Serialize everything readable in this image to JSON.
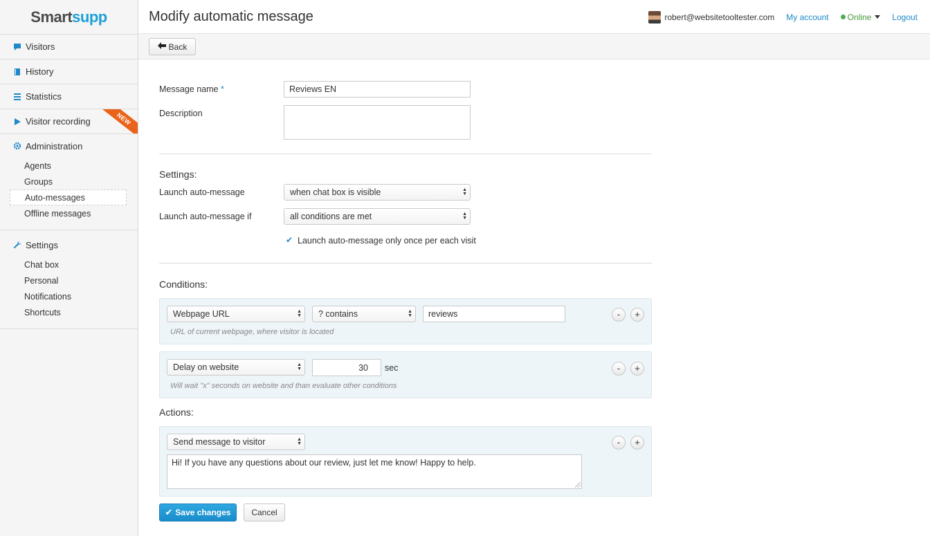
{
  "brand": {
    "part1": "Smart",
    "part2": "supp"
  },
  "sidebar": {
    "items": [
      {
        "label": "Visitors"
      },
      {
        "label": "History"
      },
      {
        "label": "Statistics"
      },
      {
        "label": "Visitor recording",
        "badge": "NEW"
      }
    ],
    "administration": {
      "label": "Administration",
      "items": [
        "Agents",
        "Groups",
        "Auto-messages",
        "Offline messages"
      ],
      "active": "Auto-messages"
    },
    "settings": {
      "label": "Settings",
      "items": [
        "Chat box",
        "Personal",
        "Notifications",
        "Shortcuts"
      ]
    }
  },
  "header": {
    "title": "Modify automatic message",
    "user_email": "robert@websitetooltester.com",
    "my_account": "My account",
    "status": "Online",
    "logout": "Logout"
  },
  "toolbar": {
    "back_label": "Back"
  },
  "form": {
    "message_name_label": "Message name",
    "required_mark": "*",
    "message_name_value": "Reviews EN",
    "description_label": "Description",
    "description_value": "",
    "settings_title": "Settings:",
    "launch_label": "Launch auto-message",
    "launch_value": "when chat box is visible",
    "launch_if_label": "Launch auto-message if",
    "launch_if_value": "all conditions are met",
    "once_label": "Launch auto-message only once per each visit",
    "once_checked": true,
    "conditions_title": "Conditions:",
    "conditions": [
      {
        "type": "Webpage URL",
        "operator": "? contains",
        "value": "reviews",
        "hint": "URL of current webpage, where visitor is located"
      },
      {
        "type": "Delay on website",
        "value": "30",
        "unit": "sec",
        "hint": "Will wait \"x\" seconds on website and than evaluate other conditions"
      }
    ],
    "actions_title": "Actions:",
    "action": {
      "type": "Send message to visitor",
      "message": "Hi! If you have any questions about our review, just let me know! Happy to help."
    },
    "minus": "-",
    "plus": "+",
    "save_label": "Save changes",
    "cancel_label": "Cancel"
  },
  "colors": {
    "accent": "#1e9fd8",
    "link": "#1e88c8",
    "badge": "#e9631a",
    "online": "#4caf50"
  }
}
